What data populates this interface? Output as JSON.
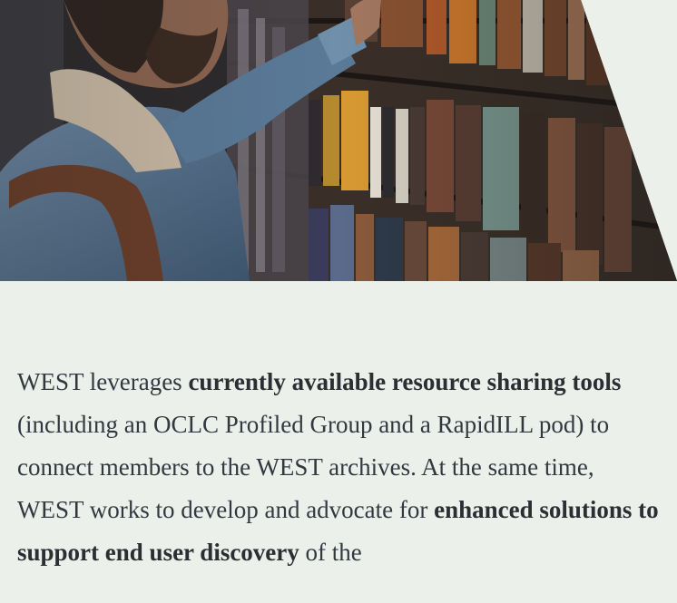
{
  "hero": {
    "image": "library-bookshelf-photo",
    "colors": {
      "background": "#ebf0eb",
      "shelf_dark": "#2a2420",
      "denim": "#5a7a98",
      "skin": "#8a6450"
    }
  },
  "intro": {
    "p1": "WEST leverages ",
    "b1": "currently available resource sharing tools",
    "p2": " (including an OCLC Profiled Group and a RapidILL pod) to connect members to the WEST archives. At the same time, WEST works to develop and advocate for ",
    "b2": "enhanced solutions to support end user discovery",
    "p3": " of the"
  }
}
